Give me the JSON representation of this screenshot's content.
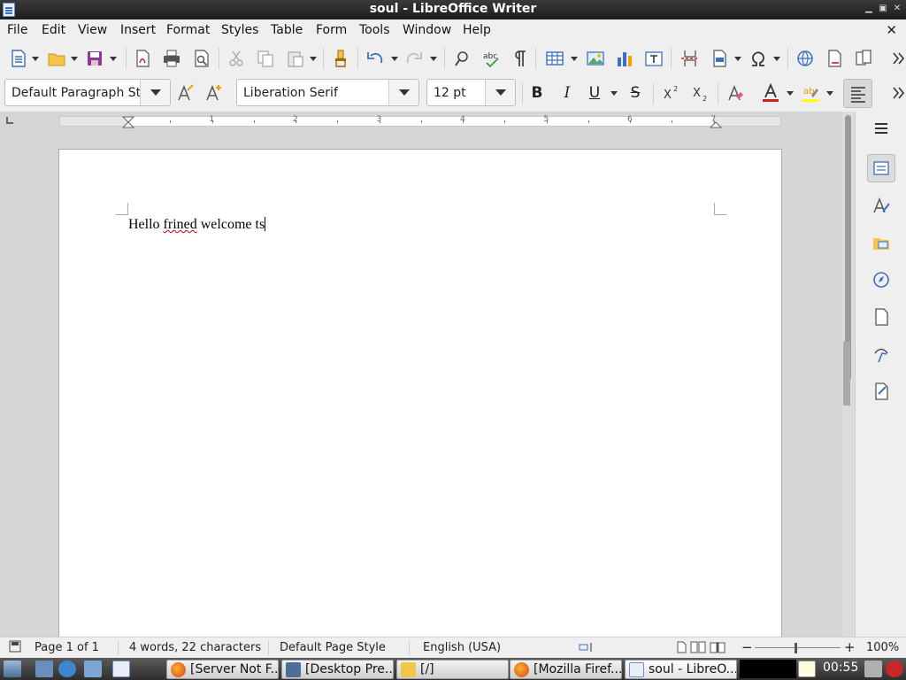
{
  "window": {
    "title": "soul - LibreOffice Writer"
  },
  "menu": [
    "File",
    "Edit",
    "View",
    "Insert",
    "Format",
    "Styles",
    "Table",
    "Form",
    "Tools",
    "Window",
    "Help"
  ],
  "toolbar2": {
    "paragraph_style": "Default Paragraph Sty",
    "font_name": "Liberation Serif",
    "font_size": "12 pt",
    "bold": "B",
    "italic": "I",
    "underline": "U",
    "strike": "S"
  },
  "ruler": {
    "numbers": [
      "1",
      "2",
      "3",
      "4",
      "5",
      "6",
      "7"
    ]
  },
  "document": {
    "text_parts": [
      "Hello ",
      "frined",
      " welcome ts"
    ]
  },
  "statusbar": {
    "page": "Page 1 of 1",
    "count": "4 words, 22 characters",
    "page_style": "Default Page Style",
    "language": "English (USA)",
    "zoom": "100%"
  },
  "taskbar": {
    "tasks": [
      "[Server Not F...",
      "[Desktop Pre...",
      "[/]",
      "[Mozilla Firef...",
      "soul - LibreO..."
    ],
    "clock": "00:55"
  },
  "colors": {
    "font_color": "#c9211e",
    "highlight": "#ffff00",
    "accent": "#3b6fc1"
  }
}
